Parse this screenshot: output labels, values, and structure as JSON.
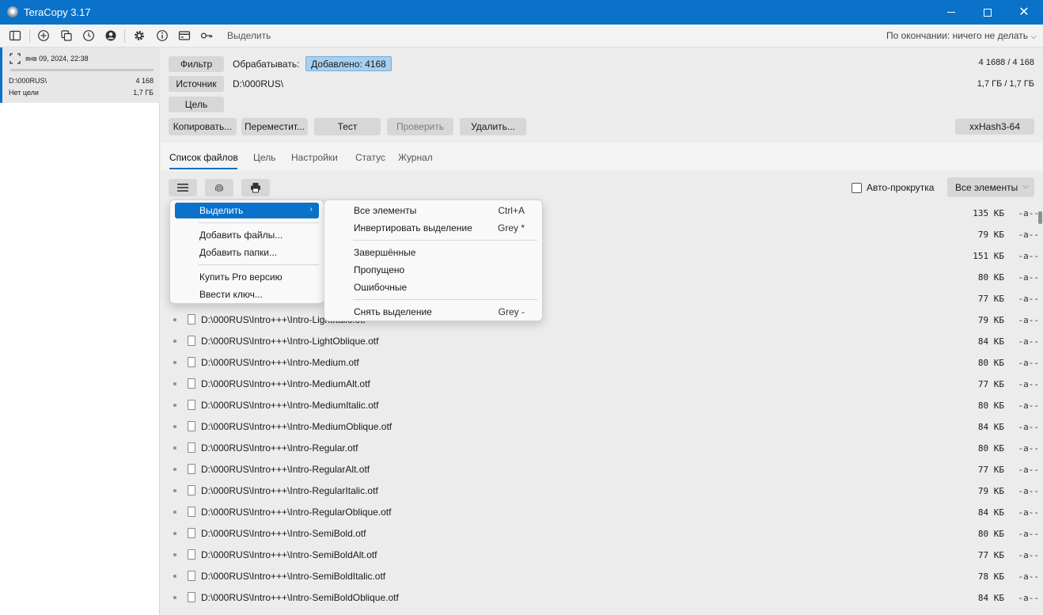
{
  "window": {
    "title": "TeraCopy 3.17",
    "icon": "teracopy-logo"
  },
  "toolbar": {
    "select_label": "Выделить",
    "on_finish_label": "По окончании: ничего не делать"
  },
  "job": {
    "date": "янв 09, 2024, 22:38",
    "source": "D:\\000RUS\\",
    "count": "4 168",
    "destination": "Нет цели",
    "size": "1,7 ГБ"
  },
  "header": {
    "filter_btn": "Фильтр",
    "process_label": "Обрабатывать:",
    "added_badge": "Добавлено: 4168",
    "source_btn": "Источник",
    "source_path": "D:\\000RUS\\",
    "target_btn": "Цель",
    "count_stat": "4 1688 / 4 168",
    "size_stat": "1,7 ГБ / 1,7 ГБ",
    "hash_btn": "xxHash3-64"
  },
  "actions": {
    "copy": "Копировать...",
    "move": "Переместит...",
    "test": "Тест",
    "verify": "Проверить",
    "delete": "Удалить..."
  },
  "tabs": {
    "files": "Список файлов",
    "target": "Цель",
    "settings": "Настройки",
    "status": "Статус",
    "log": "Журнал"
  },
  "list_controls": {
    "auto_scroll": "Авто-прокрутка",
    "filter_dropdown": "Все элементы"
  },
  "context_menu": {
    "select": "Выделить",
    "add_files": "Добавить файлы...",
    "add_folders": "Добавить папки...",
    "buy_pro": "Купить Pro версию",
    "enter_key": "Ввести ключ..."
  },
  "submenu": {
    "all": "Все элементы",
    "all_shortcut": "Ctrl+A",
    "invert": "Инвертировать выделение",
    "invert_shortcut": "Grey *",
    "completed": "Завершённые",
    "skipped": "Пропущено",
    "errors": "Ошибочные",
    "clear": "Снять выделение",
    "clear_shortcut": "Grey -"
  },
  "files": [
    {
      "name": "",
      "size": "135 КБ",
      "attr": "-a--"
    },
    {
      "name": "",
      "size": "79 КБ",
      "attr": "-a--"
    },
    {
      "name": "",
      "size": "151 КБ",
      "attr": "-a--"
    },
    {
      "name": "",
      "size": "80 КБ",
      "attr": "-a--"
    },
    {
      "name": "",
      "size": "77 КБ",
      "attr": "-a--"
    },
    {
      "name": "D:\\000RUS\\Intro+++\\Intro-LightItalic.otf",
      "size": "79 КБ",
      "attr": "-a--"
    },
    {
      "name": "D:\\000RUS\\Intro+++\\Intro-LightOblique.otf",
      "size": "84 КБ",
      "attr": "-a--"
    },
    {
      "name": "D:\\000RUS\\Intro+++\\Intro-Medium.otf",
      "size": "80 КБ",
      "attr": "-a--"
    },
    {
      "name": "D:\\000RUS\\Intro+++\\Intro-MediumAlt.otf",
      "size": "77 КБ",
      "attr": "-a--"
    },
    {
      "name": "D:\\000RUS\\Intro+++\\Intro-MediumItalic.otf",
      "size": "80 КБ",
      "attr": "-a--"
    },
    {
      "name": "D:\\000RUS\\Intro+++\\Intro-MediumOblique.otf",
      "size": "84 КБ",
      "attr": "-a--"
    },
    {
      "name": "D:\\000RUS\\Intro+++\\Intro-Regular.otf",
      "size": "80 КБ",
      "attr": "-a--"
    },
    {
      "name": "D:\\000RUS\\Intro+++\\Intro-RegularAlt.otf",
      "size": "77 КБ",
      "attr": "-a--"
    },
    {
      "name": "D:\\000RUS\\Intro+++\\Intro-RegularItalic.otf",
      "size": "79 КБ",
      "attr": "-a--"
    },
    {
      "name": "D:\\000RUS\\Intro+++\\Intro-RegularOblique.otf",
      "size": "84 КБ",
      "attr": "-a--"
    },
    {
      "name": "D:\\000RUS\\Intro+++\\Intro-SemiBold.otf",
      "size": "80 КБ",
      "attr": "-a--"
    },
    {
      "name": "D:\\000RUS\\Intro+++\\Intro-SemiBoldAlt.otf",
      "size": "77 КБ",
      "attr": "-a--"
    },
    {
      "name": "D:\\000RUS\\Intro+++\\Intro-SemiBoldItalic.otf",
      "size": "78 КБ",
      "attr": "-a--"
    },
    {
      "name": "D:\\000RUS\\Intro+++\\Intro-SemiBoldOblique.otf",
      "size": "84 КБ",
      "attr": "-a--"
    }
  ],
  "colors": {
    "accent": "#0a72c9",
    "badge": "#a8cfee"
  }
}
